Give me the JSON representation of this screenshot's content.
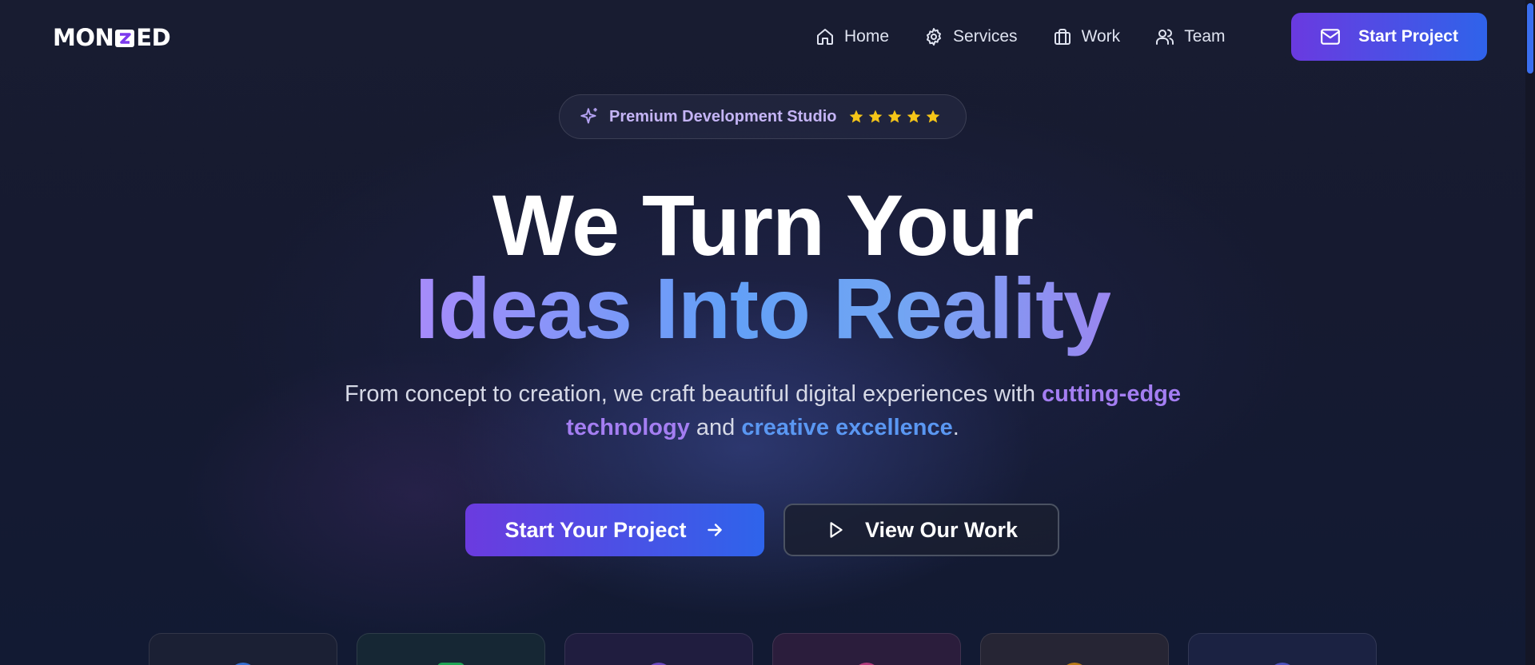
{
  "brand": {
    "logo_left": "MON",
    "logo_right": "ED"
  },
  "nav": {
    "items": [
      {
        "label": "Home",
        "icon": "home-icon"
      },
      {
        "label": "Services",
        "icon": "gear-icon"
      },
      {
        "label": "Work",
        "icon": "briefcase-icon"
      },
      {
        "label": "Team",
        "icon": "users-icon"
      }
    ],
    "cta_label": "Start Project",
    "cta_icon": "mail-icon"
  },
  "badge": {
    "text": "Premium Development Studio",
    "icon": "sparkle-icon",
    "stars": 5
  },
  "hero": {
    "title_line1": "We Turn Your",
    "title_line2": "Ideas Into Reality",
    "subtitle_pre": "From concept to creation, we craft beautiful digital experiences with ",
    "subtitle_highlight1": "cutting-edge technology",
    "subtitle_mid": " and ",
    "subtitle_highlight2": "creative excellence",
    "subtitle_post": "."
  },
  "actions": {
    "primary_label": "Start Your Project",
    "primary_icon": "arrow-right-icon",
    "secondary_label": "View Our Work",
    "secondary_icon": "play-icon"
  },
  "colors": {
    "accent_purple": "#6b3bdf",
    "accent_blue": "#2e64eb",
    "highlight_purple": "#a47ef2",
    "highlight_blue": "#5a97f2",
    "star": "#f5c518"
  }
}
